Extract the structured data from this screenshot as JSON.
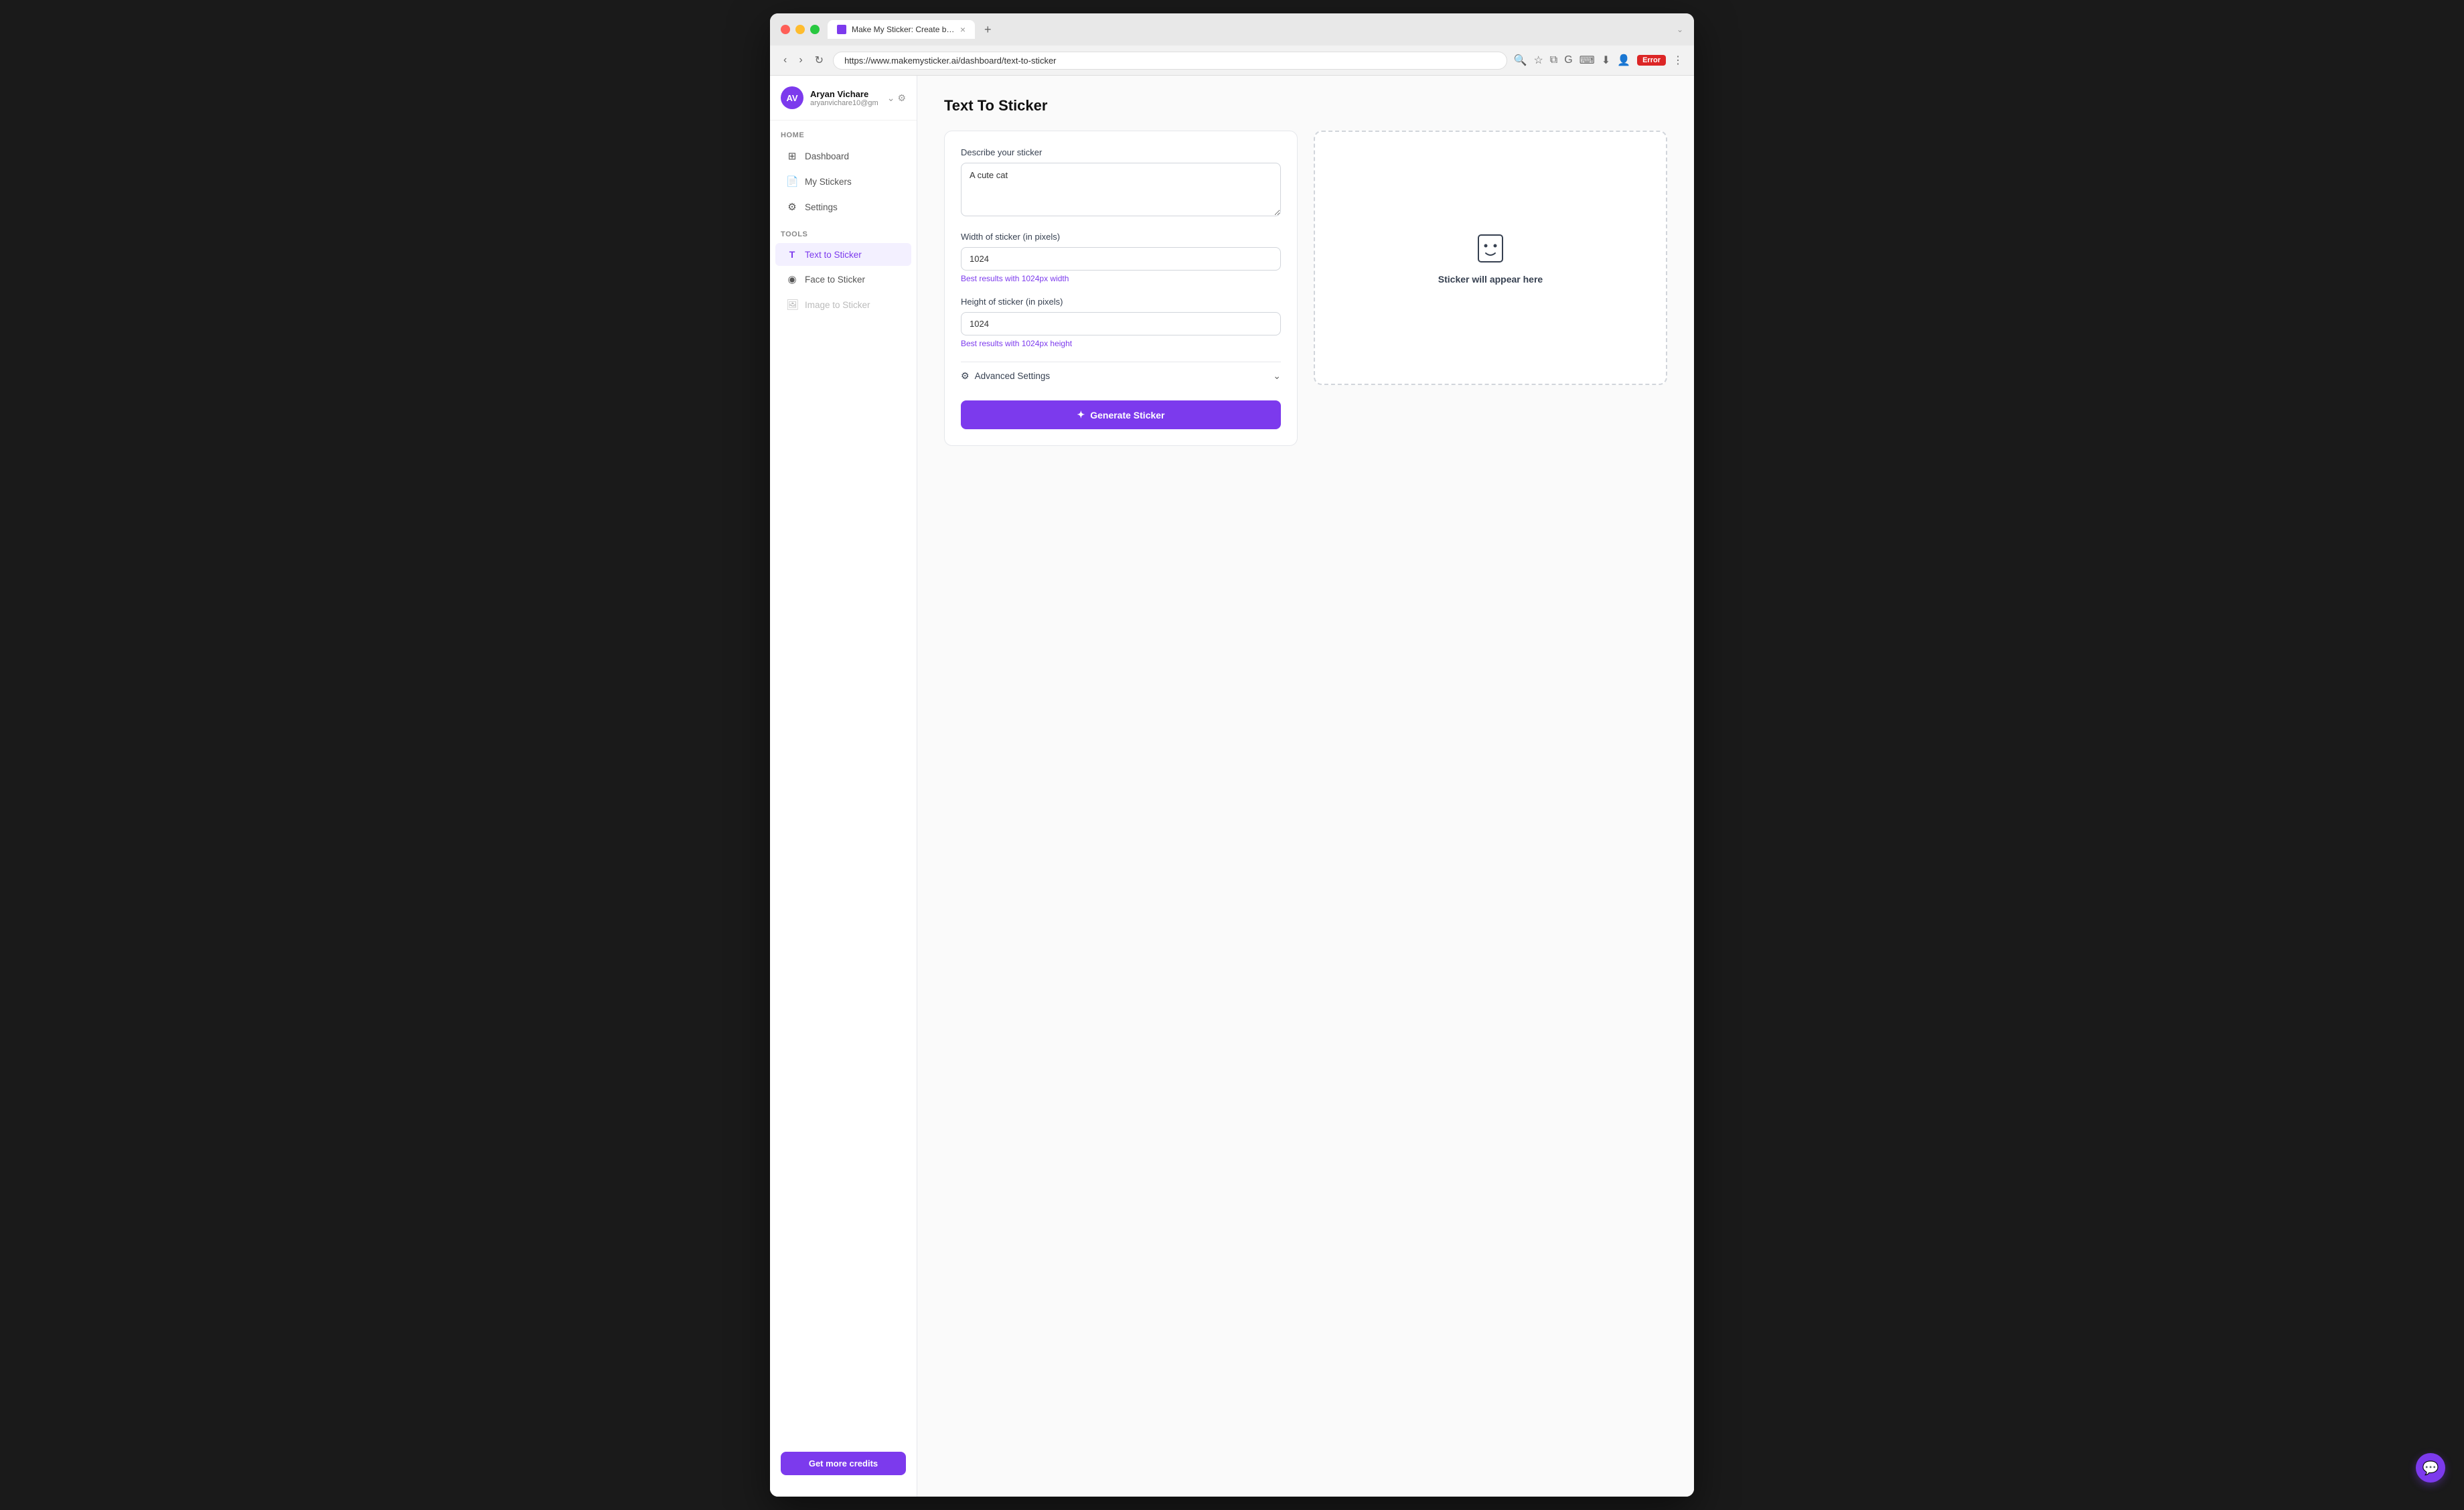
{
  "browser": {
    "tab_title": "Make My Sticker: Create be...",
    "url": "https://www.makemysticker.ai/dashboard/text-to-sticker",
    "error_label": "Error"
  },
  "sidebar": {
    "user": {
      "name": "Aryan Vichare",
      "email": "aryanvichare10@gm",
      "avatar_initials": "AV"
    },
    "home_section": "Home",
    "tools_section": "Tools",
    "nav_items": [
      {
        "id": "dashboard",
        "label": "Dashboard",
        "icon": "⊞",
        "active": false,
        "disabled": false
      },
      {
        "id": "my-stickers",
        "label": "My Stickers",
        "icon": "📄",
        "active": false,
        "disabled": false
      },
      {
        "id": "settings",
        "label": "Settings",
        "icon": "⚙",
        "active": false,
        "disabled": false
      }
    ],
    "tools_items": [
      {
        "id": "text-to-sticker",
        "label": "Text to Sticker",
        "icon": "T",
        "active": true,
        "disabled": false
      },
      {
        "id": "face-to-sticker",
        "label": "Face to Sticker",
        "icon": "◉",
        "active": false,
        "disabled": false
      },
      {
        "id": "image-to-sticker",
        "label": "Image to Sticker",
        "icon": "🖼",
        "active": false,
        "disabled": true
      }
    ],
    "credits_button": "Get more credits"
  },
  "main": {
    "page_title": "Text To Sticker",
    "form": {
      "describe_label": "Describe your sticker",
      "describe_placeholder": "A cute cat",
      "describe_value": "A cute cat",
      "width_label": "Width of sticker (in pixels)",
      "width_value": "1024",
      "width_hint": "Best results with 1024px width",
      "height_label": "Height of sticker (in pixels)",
      "height_value": "1024",
      "height_hint": "Best results with 1024px height",
      "advanced_settings_label": "Advanced Settings",
      "generate_button": "Generate Sticker",
      "generate_icon": "✦"
    },
    "preview": {
      "placeholder_text": "Sticker will appear here"
    }
  }
}
